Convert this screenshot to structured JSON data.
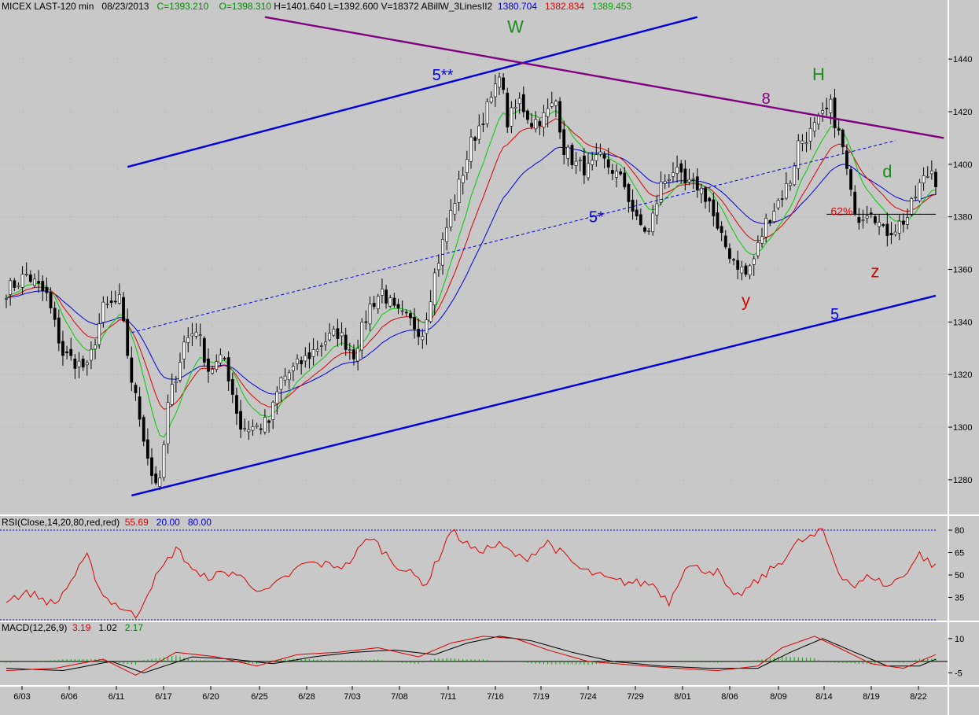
{
  "header": {
    "symbol": "MICEX LAST-120 min",
    "date": "08/23/2013",
    "close": "C=1393.210",
    "open": "O=1398.310",
    "high": "H=1401.640",
    "low": "L=1392.600",
    "volume": "V=18372",
    "indicator": "ABillW_3LinesII2",
    "line1": "1380.704",
    "line2": "1382.834",
    "line3": "1389.453"
  },
  "rsi_header": {
    "label": "RSI(Close,14,20,80,red,red)",
    "value": "55.69",
    "low": "20.00",
    "high": "80.00"
  },
  "macd_header": {
    "label": "MACD(12,26,9)",
    "v1": "3.19",
    "v2": "1.02",
    "v3": "2.17"
  },
  "colors": {
    "bg": "#c8c8c8",
    "candle": "#000000",
    "blue": "#0000dd",
    "red": "#dd0000",
    "green": "#00cc00",
    "purple": "#800080",
    "maroon": "#8b0000",
    "wave_green": "#1a8a1a"
  },
  "chart_data": [
    {
      "type": "candlestick",
      "title": "MICEX LAST-120 min",
      "ylim": [
        1268,
        1458
      ],
      "y_ticks": [
        1280,
        1300,
        1320,
        1340,
        1360,
        1380,
        1400,
        1420,
        1440
      ],
      "x_tick_labels": [
        "6/03",
        "6/06",
        "6/11",
        "6/17",
        "6/20",
        "6/25",
        "6/28",
        "7/03",
        "7/08",
        "7/11",
        "7/16",
        "7/19",
        "7/24",
        "7/29",
        "8/01",
        "8/06",
        "8/09",
        "8/14",
        "8/19",
        "8/22"
      ],
      "close_anchors": [
        [
          0,
          1352
        ],
        [
          5,
          1358
        ],
        [
          10,
          1350
        ],
        [
          14,
          1328
        ],
        [
          20,
          1322
        ],
        [
          24,
          1345
        ],
        [
          28,
          1348
        ],
        [
          31,
          1318
        ],
        [
          33,
          1304
        ],
        [
          36,
          1282
        ],
        [
          38,
          1278
        ],
        [
          40,
          1308
        ],
        [
          44,
          1332
        ],
        [
          47,
          1338
        ],
        [
          50,
          1322
        ],
        [
          54,
          1326
        ],
        [
          58,
          1300
        ],
        [
          62,
          1300
        ],
        [
          65,
          1302
        ],
        [
          68,
          1318
        ],
        [
          71,
          1322
        ],
        [
          74,
          1326
        ],
        [
          78,
          1332
        ],
        [
          82,
          1336
        ],
        [
          86,
          1328
        ],
        [
          90,
          1346
        ],
        [
          93,
          1352
        ],
        [
          96,
          1344
        ],
        [
          100,
          1340
        ],
        [
          103,
          1336
        ],
        [
          106,
          1358
        ],
        [
          109,
          1376
        ],
        [
          112,
          1392
        ],
        [
          115,
          1408
        ],
        [
          118,
          1418
        ],
        [
          121,
          1428
        ],
        [
          122,
          1436
        ],
        [
          124,
          1416
        ],
        [
          127,
          1424
        ],
        [
          130,
          1416
        ],
        [
          133,
          1418
        ],
        [
          136,
          1424
        ],
        [
          138,
          1406
        ],
        [
          141,
          1400
        ],
        [
          144,
          1398
        ],
        [
          147,
          1402
        ],
        [
          150,
          1398
        ],
        [
          153,
          1392
        ],
        [
          156,
          1378
        ],
        [
          159,
          1374
        ],
        [
          162,
          1392
        ],
        [
          165,
          1398
        ],
        [
          168,
          1392
        ],
        [
          171,
          1392
        ],
        [
          174,
          1386
        ],
        [
          176,
          1374
        ],
        [
          179,
          1366
        ],
        [
          181,
          1362
        ],
        [
          183,
          1358
        ],
        [
          185,
          1364
        ],
        [
          188,
          1378
        ],
        [
          191,
          1386
        ],
        [
          194,
          1394
        ],
        [
          196,
          1408
        ],
        [
          199,
          1412
        ],
        [
          202,
          1418
        ],
        [
          204,
          1422
        ],
        [
          207,
          1406
        ],
        [
          209,
          1388
        ],
        [
          211,
          1380
        ],
        [
          214,
          1384
        ],
        [
          217,
          1374
        ],
        [
          220,
          1376
        ],
        [
          223,
          1380
        ],
        [
          226,
          1392
        ],
        [
          229,
          1398
        ],
        [
          230,
          1394
        ]
      ],
      "moving_averages": [
        {
          "name": "1380.704",
          "color": "#0000dd"
        },
        {
          "name": "1382.834",
          "color": "#dd0000"
        },
        {
          "name": "1389.453",
          "color": "#00cc00"
        }
      ],
      "trendlines": [
        {
          "from": [
            31,
            1274
          ],
          "to": [
            230,
            1350
          ],
          "label": "5",
          "color": "#0000dd",
          "style": "solid"
        },
        {
          "from": [
            31,
            1336
          ],
          "to": [
            220,
            1409
          ],
          "label": "5*",
          "color": "#0000dd",
          "style": "dashed"
        },
        {
          "from": [
            30,
            1399
          ],
          "to": [
            171,
            1456
          ],
          "label": "5**",
          "color": "#0000dd",
          "style": "solid"
        },
        {
          "from": [
            64,
            1456
          ],
          "to": [
            232,
            1410
          ],
          "label": "8",
          "color": "#800080",
          "style": "solid"
        }
      ],
      "horizontal_line": {
        "from": 203,
        "to": 230,
        "y": 1381,
        "label": "62%"
      },
      "wave_labels": [
        {
          "text": "W",
          "x": 126,
          "y": 1450,
          "color": "#1a8a1a"
        },
        {
          "text": "H",
          "x": 201,
          "y": 1432,
          "color": "#1a8a1a"
        },
        {
          "text": "d",
          "x": 218,
          "y": 1395,
          "color": "#1a8a1a"
        },
        {
          "text": "y",
          "x": 183,
          "y": 1346,
          "color": "#dd0000"
        },
        {
          "text": "z",
          "x": 215,
          "y": 1357,
          "color": "#dd0000"
        }
      ]
    },
    {
      "type": "line",
      "title": "RSI(Close,14,20,80,red,red)",
      "ylim": [
        20,
        80
      ],
      "y_ticks": [
        35,
        50,
        65,
        80
      ],
      "series": [
        {
          "name": "RSI",
          "color": "#dd0000",
          "anchors": [
            [
              0,
              34
            ],
            [
              6,
              38
            ],
            [
              12,
              30
            ],
            [
              20,
              62
            ],
            [
              24,
              36
            ],
            [
              32,
              22
            ],
            [
              36,
              44
            ],
            [
              42,
              68
            ],
            [
              48,
              48
            ],
            [
              56,
              52
            ],
            [
              64,
              38
            ],
            [
              74,
              58
            ],
            [
              84,
              56
            ],
            [
              90,
              76
            ],
            [
              96,
              58
            ],
            [
              104,
              44
            ],
            [
              110,
              80
            ],
            [
              116,
              66
            ],
            [
              122,
              70
            ],
            [
              128,
              60
            ],
            [
              134,
              72
            ],
            [
              142,
              54
            ],
            [
              150,
              46
            ],
            [
              160,
              44
            ],
            [
              164,
              32
            ],
            [
              168,
              56
            ],
            [
              176,
              52
            ],
            [
              180,
              34
            ],
            [
              186,
              46
            ],
            [
              192,
              60
            ],
            [
              196,
              72
            ],
            [
              200,
              76
            ],
            [
              202,
              80
            ],
            [
              206,
              52
            ],
            [
              210,
              42
            ],
            [
              214,
              50
            ],
            [
              218,
              42
            ],
            [
              222,
              50
            ],
            [
              226,
              64
            ],
            [
              230,
              55
            ]
          ]
        }
      ],
      "reference_lines": [
        20,
        80
      ]
    },
    {
      "type": "line",
      "title": "MACD(12,26,9)",
      "ylim": [
        -10,
        12
      ],
      "y_ticks": [
        -5,
        10
      ],
      "series": [
        {
          "name": "3.19",
          "color": "#dd0000",
          "anchors": [
            [
              0,
              -4
            ],
            [
              12,
              -3
            ],
            [
              24,
              1
            ],
            [
              32,
              -6
            ],
            [
              42,
              4
            ],
            [
              52,
              2
            ],
            [
              62,
              -2
            ],
            [
              72,
              3
            ],
            [
              82,
              4
            ],
            [
              92,
              6
            ],
            [
              102,
              2
            ],
            [
              110,
              8
            ],
            [
              118,
              11
            ],
            [
              126,
              10
            ],
            [
              134,
              5
            ],
            [
              144,
              0
            ],
            [
              158,
              -2
            ],
            [
              166,
              -3
            ],
            [
              176,
              -4
            ],
            [
              186,
              -2
            ],
            [
              192,
              6
            ],
            [
              200,
              11
            ],
            [
              206,
              6
            ],
            [
              214,
              -1
            ],
            [
              222,
              -3
            ],
            [
              230,
              3
            ]
          ]
        },
        {
          "name": "1.02",
          "color": "#000000",
          "anchors": [
            [
              0,
              -3
            ],
            [
              14,
              -4
            ],
            [
              26,
              0
            ],
            [
              34,
              -5
            ],
            [
              46,
              2
            ],
            [
              56,
              1
            ],
            [
              66,
              -1
            ],
            [
              76,
              2
            ],
            [
              86,
              4
            ],
            [
              96,
              5
            ],
            [
              106,
              3
            ],
            [
              114,
              8
            ],
            [
              122,
              11
            ],
            [
              130,
              9
            ],
            [
              140,
              4
            ],
            [
              150,
              0
            ],
            [
              162,
              -2
            ],
            [
              174,
              -3
            ],
            [
              186,
              -3
            ],
            [
              194,
              4
            ],
            [
              202,
              10
            ],
            [
              210,
              4
            ],
            [
              218,
              -2
            ],
            [
              226,
              -2
            ],
            [
              230,
              1
            ]
          ]
        }
      ],
      "histogram_label": "2.17"
    }
  ]
}
